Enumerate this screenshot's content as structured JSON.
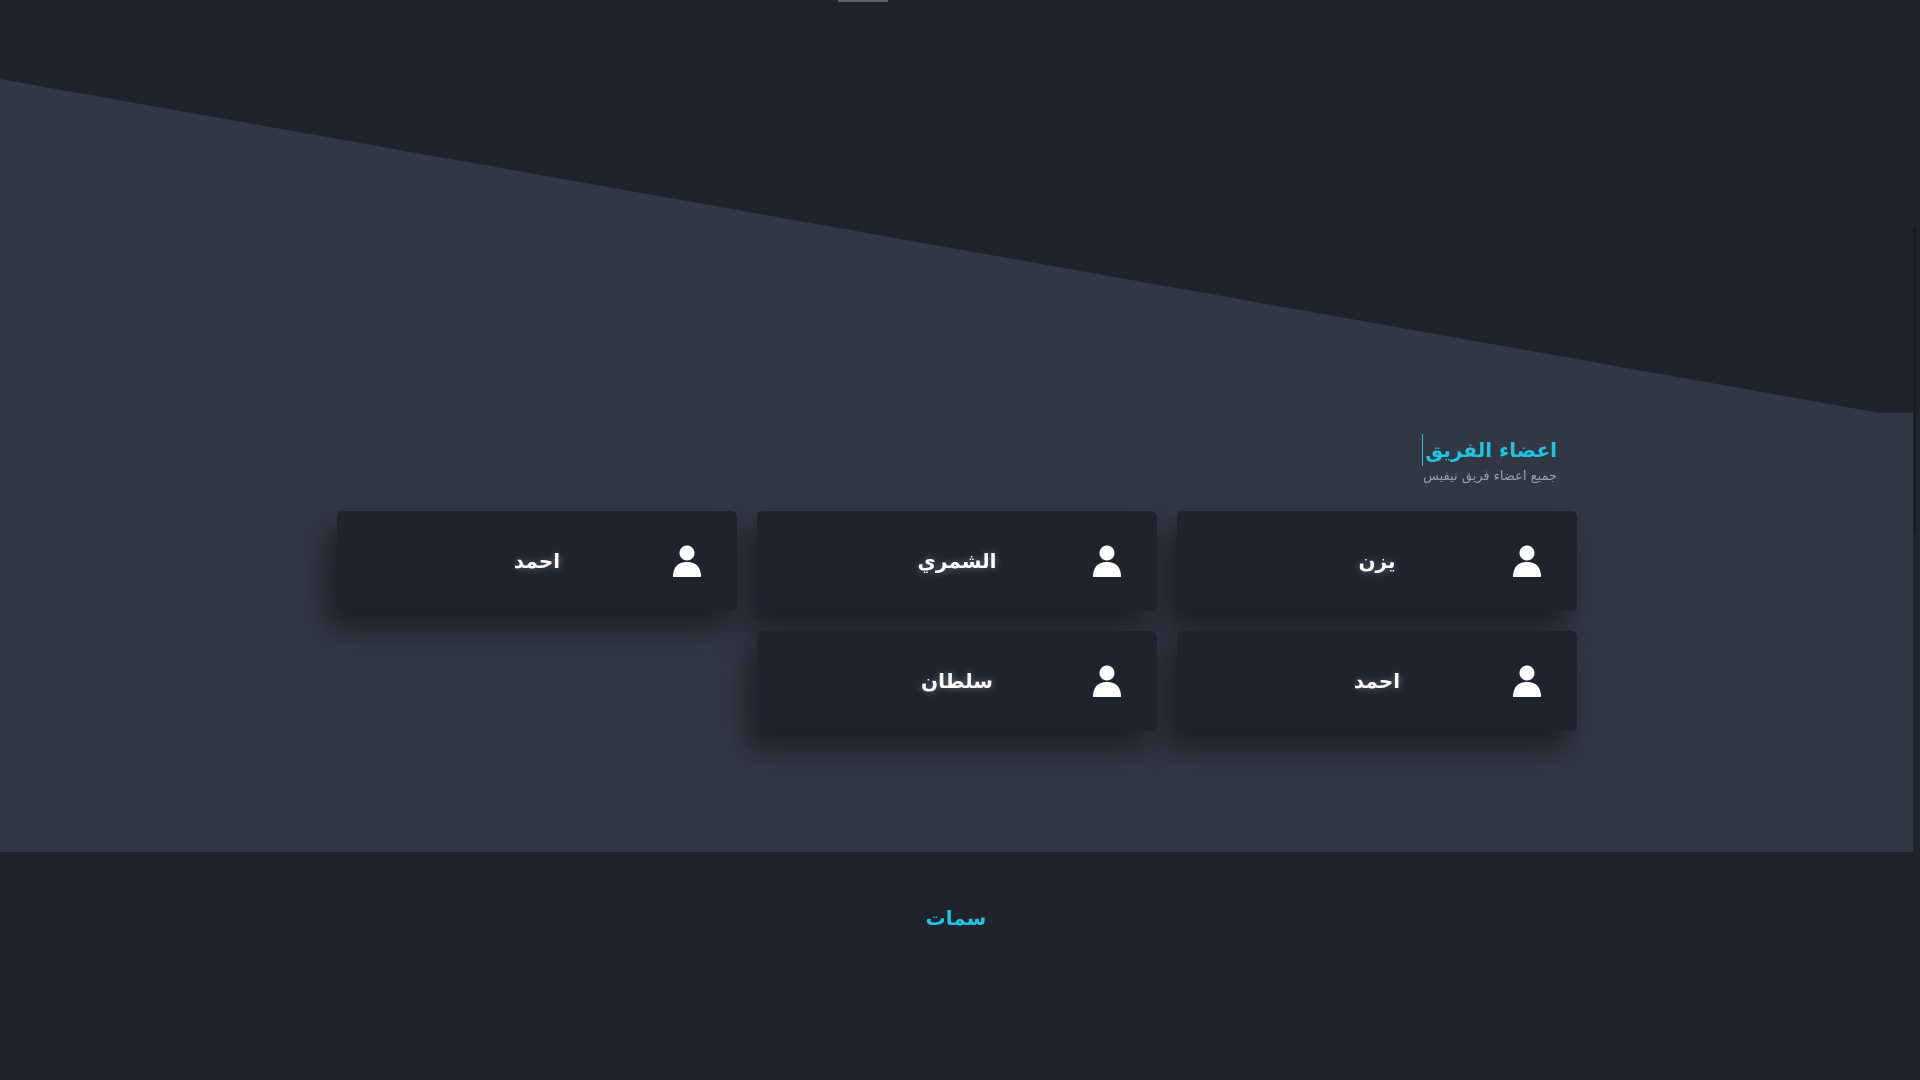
{
  "team": {
    "title": "اعضاء الفريق",
    "subtitle": "جميع اعضاء فريق نيفيس",
    "members": [
      {
        "name": "يزن",
        "icon": "user-icon"
      },
      {
        "name": "الشمري",
        "icon": "user-icon"
      },
      {
        "name": "احمد",
        "icon": "user-icon"
      },
      {
        "name": "احمد",
        "icon": "user-icon"
      },
      {
        "name": "سلطان",
        "icon": "user-icon"
      }
    ]
  },
  "footer": {
    "brand": "سمات"
  },
  "colors": {
    "background": "#1f232e",
    "section_background": "#323744",
    "accent": "#1ec4e0",
    "card": "#1f232e",
    "text": "#ffffff",
    "muted_text": "#9aa0ab"
  }
}
